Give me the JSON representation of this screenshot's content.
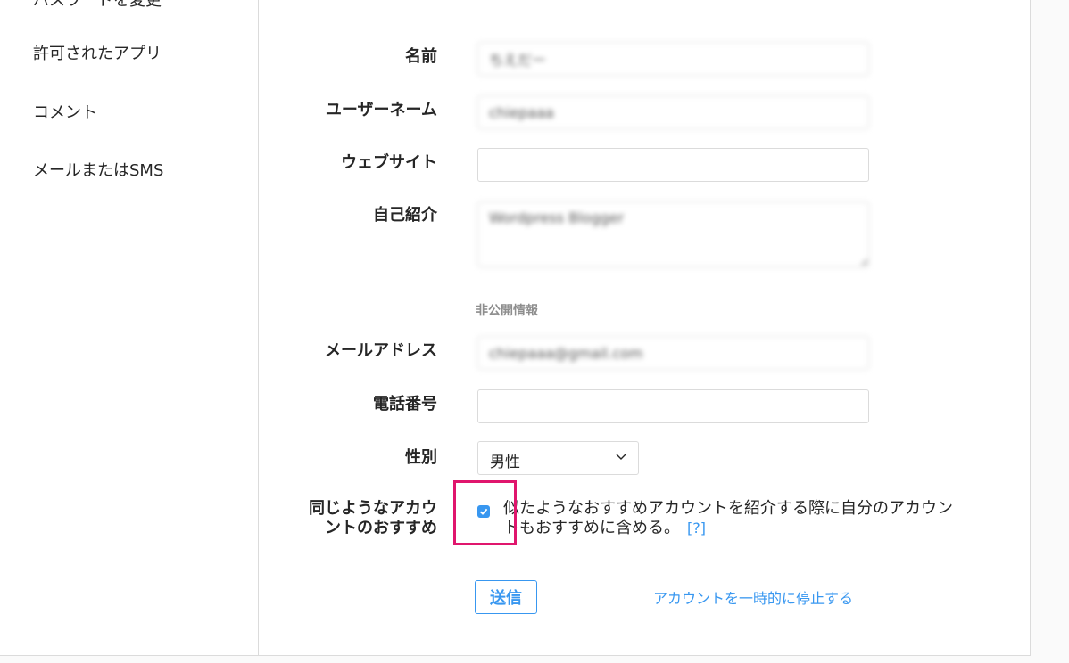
{
  "sidebar": {
    "items": [
      {
        "label": "パスワードを変更"
      },
      {
        "label": "許可されたアプリ"
      },
      {
        "label": "コメント"
      },
      {
        "label": "メールまたはSMS"
      }
    ]
  },
  "form": {
    "name": {
      "label": "名前",
      "value": "ちえだー"
    },
    "username": {
      "label": "ユーザーネーム",
      "value": "chiepaaa"
    },
    "website": {
      "label": "ウェブサイト",
      "value": ""
    },
    "bio": {
      "label": "自己紹介",
      "value": "Wordpress Blogger"
    },
    "private_info_header": "非公開情報",
    "email": {
      "label": "メールアドレス",
      "value": "chiepaaa@gmail.com"
    },
    "phone": {
      "label": "電話番号",
      "value": ""
    },
    "gender": {
      "label": "性別",
      "value": "男性"
    },
    "suggestions": {
      "label_line1": "同じようなアカウ",
      "label_line2": "ントのおすすめ",
      "checked": true,
      "text": "似たようなおすすめアカウントを紹介する際に自分のアカウントもおすすめに含める。",
      "help": "[?]"
    },
    "submit_label": "送信",
    "disable_link": "アカウントを一時的に停止する"
  },
  "colors": {
    "accent": "#3897f0",
    "highlight": "#e0166d",
    "border": "#dbdbdb"
  }
}
